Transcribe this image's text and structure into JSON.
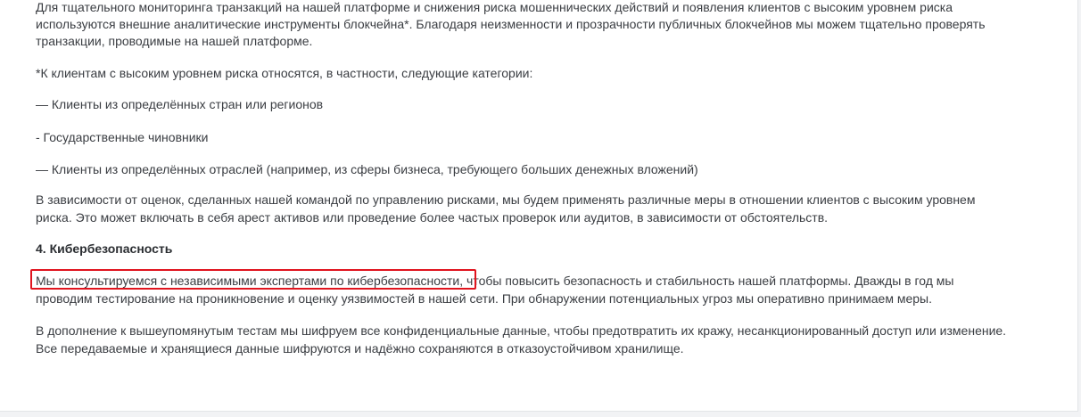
{
  "document": {
    "paragraph_intro": {
      "line1": "Для тщательного мониторинга транзакций на нашей платформе и снижения риска мошеннических действий и появления клиентов с высоким уровнем риска",
      "line2": "используются внешние аналитические инструменты блокчейна*. Благодаря неизменности и прозрачности публичных блокчейнов мы можем тщательно проверять",
      "line3": "транзакции, проводимые на нашей платформе."
    },
    "footnote": "*К клиентам с высоким уровнем риска относятся, в частности, следующие категории:",
    "categories": [
      "— Клиенты из определённых стран или регионов",
      "- Государственные чиновники",
      "— Клиенты из определённых отраслей (например, из сферы бизнеса, требующего больших денежных вложений)"
    ],
    "paragraph_measures": {
      "line1": "В зависимости от оценок, сделанных нашей командой по управлению рисками, мы будем применять различные меры в отношении клиентов с высоким уровнем",
      "line2": "риска. Это может включать в себя арест активов или проведение более частых проверок или аудитов, в зависимости от обстоятельств."
    },
    "section_heading": "4. Кибербезопасность",
    "paragraph_cyber": {
      "highlighted": "Мы консультируемся с независимыми экспертами по кибербезопасности,",
      "line1_rest": " чтобы повысить безопасность и стабильность нашей платформы. Дважды в год мы",
      "line2": "проводим тестирование на проникновение и оценку уязвимостей в нашей сети. При обнаружении потенциальных угроз мы оперативно принимаем меры."
    },
    "paragraph_encryption": {
      "line1": "В дополнение к вышеупомянутым тестам мы шифруем все конфиденциальные данные, чтобы предотвратить их кражу, несанкционированный доступ или изменение.",
      "line2": "Все передаваемые и хранящиеся данные шифруются и надёжно сохраняются в отказоустойчивом хранилище."
    }
  },
  "colors": {
    "text": "#3a3d42",
    "highlight_border": "#e0141e",
    "background": "#ffffff"
  }
}
